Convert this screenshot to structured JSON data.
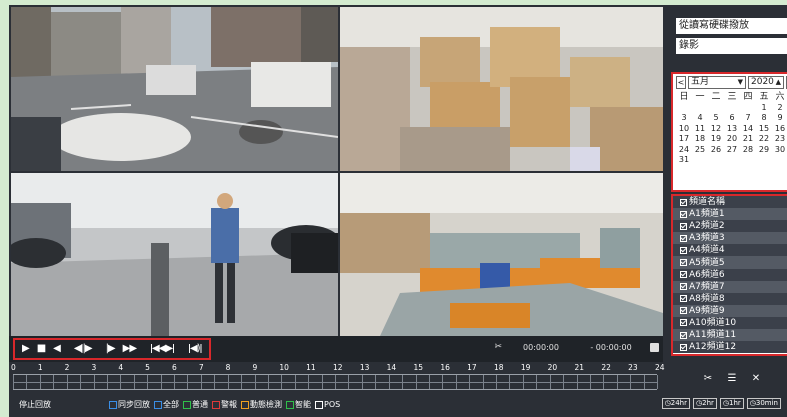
{
  "right_panel": {
    "source_select": "從讀寫硬碟撥放",
    "type_select": "錄影",
    "calendar": {
      "prev": "<",
      "next": ">",
      "month": "五月",
      "year": "2020",
      "weekdays": [
        "日",
        "一",
        "二",
        "三",
        "四",
        "五",
        "六"
      ],
      "weeks": [
        [
          "",
          "",
          "",
          "",
          "",
          "1",
          "2"
        ],
        [
          "3",
          "4",
          "5",
          "6",
          "7",
          "8",
          "9"
        ],
        [
          "10",
          "11",
          "12",
          "13",
          "14",
          "15",
          "16"
        ],
        [
          "17",
          "18",
          "19",
          "20",
          "21",
          "22",
          "23"
        ],
        [
          "24",
          "25",
          "26",
          "27",
          "28",
          "29",
          "30"
        ],
        [
          "31",
          "",
          "",
          "",
          "",
          "",
          ""
        ]
      ]
    },
    "channel_header": "頻道名稱",
    "channels": [
      "A1頻道1",
      "A2頻道2",
      "A3頻道3",
      "A4頻道4",
      "A5頻道5",
      "A6頻道6",
      "A7頻道7",
      "A8頻道8",
      "A9頻道9",
      "A10頻道10",
      "A11頻道11",
      "A12頻道12"
    ],
    "tool_icons": [
      "search-clip-icon",
      "list-icon",
      "export-icon"
    ]
  },
  "controls": {
    "play": "▶",
    "stop": "■",
    "reverse": "◀",
    "prev_frame": "◀ǀ|▶",
    "step": "|▶",
    "fast": "▶▶",
    "skip": "ǀ◀◀▶ǀ",
    "audio": "ǀ◀)ǀ",
    "clip": "✂",
    "start_time": "00:00:00",
    "end_time": "- 00:00:00"
  },
  "timeline": {
    "hours": [
      "0",
      "1",
      "2",
      "3",
      "4",
      "5",
      "6",
      "7",
      "8",
      "9",
      "10",
      "11",
      "12",
      "13",
      "14",
      "15",
      "16",
      "17",
      "18",
      "19",
      "20",
      "21",
      "22",
      "23",
      "24"
    ]
  },
  "status": {
    "text": "停止回放",
    "legend": [
      {
        "label": "同步回放",
        "color": "#3a8ee6",
        "checked": true
      },
      {
        "label": "全部",
        "color": "#3a8ee6",
        "checked": true
      },
      {
        "label": "普通",
        "color": "#2fbf4a",
        "checked": true
      },
      {
        "label": "警報",
        "color": "#e03a3a",
        "checked": true
      },
      {
        "label": "動態檢測",
        "color": "#f0a020",
        "checked": true
      },
      {
        "label": "智能",
        "color": "#2fbf4a",
        "checked": true
      },
      {
        "label": "POS",
        "color": "#ffffff",
        "checked": false
      }
    ],
    "zoom": [
      "24hr",
      "2hr",
      "1hr",
      "30min"
    ]
  },
  "colors": {
    "highlight_border": "#d8282b",
    "panel_bg": "#2b2f36",
    "page_bg": "#d4ebd0"
  }
}
